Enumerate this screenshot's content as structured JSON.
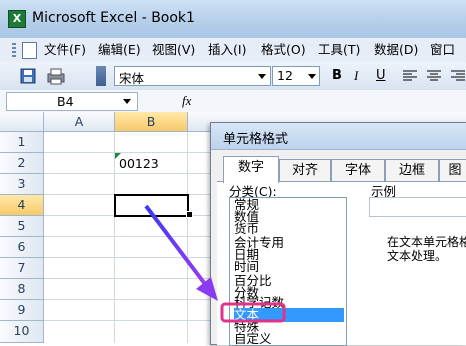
{
  "window": {
    "title": "Microsoft Excel - Book1",
    "app_icon": "X"
  },
  "menu": {
    "items": [
      "文件(F)",
      "编辑(E)",
      "视图(V)",
      "插入(I)",
      "格式(O)",
      "工具(T)",
      "数据(D)",
      "窗口"
    ]
  },
  "toolbar": {
    "font_name": "宋体",
    "font_size": "12",
    "bold": "B",
    "italic": "I",
    "underline": "U"
  },
  "formula_bar": {
    "name_box": "B4",
    "fx": "fx"
  },
  "grid": {
    "columns": [
      "A",
      "B"
    ],
    "rows": [
      "1",
      "2",
      "3",
      "4",
      "5",
      "6",
      "7",
      "8",
      "9",
      "10",
      "11"
    ],
    "cells": {
      "B2": "00123"
    }
  },
  "dialog": {
    "title": "单元格格式",
    "tabs": [
      "数字",
      "对齐",
      "字体",
      "边框",
      "图"
    ],
    "active_tab": "数字",
    "category_label": "分类(C):",
    "categories": [
      "常规",
      "数值",
      "货币",
      "会计专用",
      "日期",
      "时间",
      "百分比",
      "分数",
      "科学记数",
      "文本",
      "特殊",
      "自定义"
    ],
    "selected_category": "文本",
    "sample_label": "示例",
    "description": [
      "在文本单元格格",
      "文本处理。"
    ]
  },
  "annotation": {
    "arrow_color": "#6a3df0",
    "highlight_color": "#e0338a"
  }
}
